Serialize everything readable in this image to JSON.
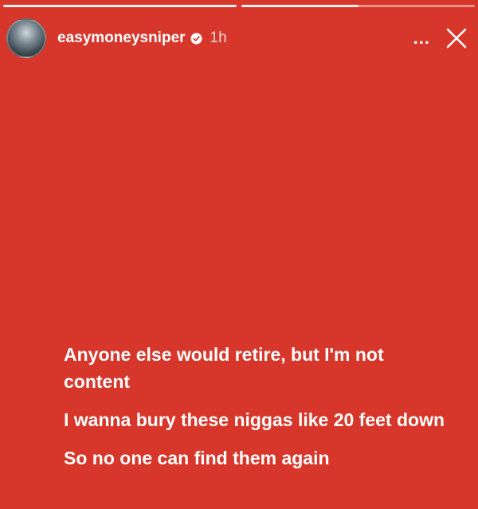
{
  "story": {
    "progress": [
      1.0,
      0.5
    ],
    "username": "easymoneysniper",
    "time_ago": "1h",
    "more_label": "...",
    "background_color": "#d7362a"
  },
  "lyrics": [
    "Anyone else would retire, but I'm not content",
    "I wanna bury these niggas like 20 feet down",
    "So no one can find them again"
  ],
  "icons": {
    "avatar": "profile-photo",
    "verified": "verified-badge-icon",
    "close": "close-icon"
  }
}
